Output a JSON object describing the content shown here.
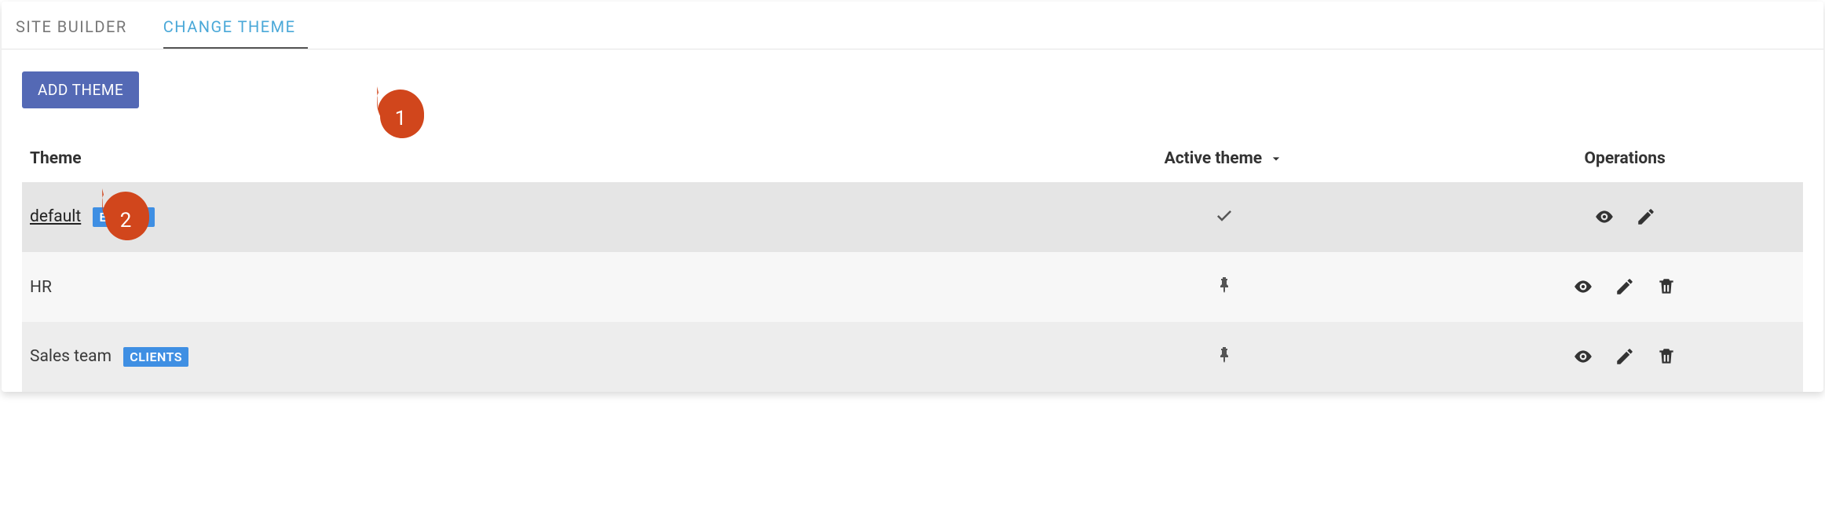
{
  "tabs": {
    "site_builder": "SITE BUILDER",
    "change_theme": "CHANGE THEME"
  },
  "buttons": {
    "add_theme": "ADD THEME"
  },
  "columns": {
    "theme": "Theme",
    "active_theme": "Active theme",
    "operations": "Operations"
  },
  "rows": [
    {
      "name": "default",
      "badge": "EFRONT",
      "status": "check",
      "ops": [
        "view",
        "edit"
      ]
    },
    {
      "name": "HR",
      "badge": null,
      "status": "pin",
      "ops": [
        "view",
        "edit",
        "delete"
      ]
    },
    {
      "name": "Sales team",
      "badge": "CLIENTS",
      "status": "pin",
      "ops": [
        "view",
        "edit",
        "delete"
      ]
    }
  ],
  "annotations": {
    "c1": "1",
    "c2": "2"
  }
}
